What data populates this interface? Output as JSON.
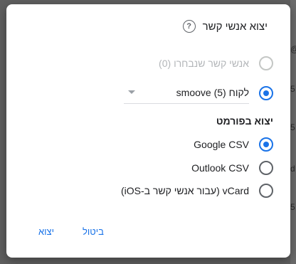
{
  "dialog": {
    "title": "יצוא אנשי קשר",
    "source_options": [
      {
        "label": "אנשי קשר שנבחרו (0)",
        "checked": false,
        "disabled": true
      },
      {
        "label": "לקוח (5) smoove",
        "checked": true,
        "disabled": false
      }
    ],
    "format_title": "יצוא בפורמט",
    "format_options": [
      {
        "label": "Google CSV",
        "checked": true
      },
      {
        "label": "Outlook CSV",
        "checked": false
      },
      {
        "label": "vCard (עבור אנשי קשר ב-iOS)",
        "checked": false
      }
    ],
    "cancel_label": "ביטול",
    "export_label": "יצוא"
  },
  "background": {
    "chars": [
      "@",
      "5",
      "5",
      "d",
      "5"
    ]
  },
  "colors": {
    "accent": "#1a73e8",
    "text": "#202124",
    "disabled": "#b3b6b9"
  }
}
